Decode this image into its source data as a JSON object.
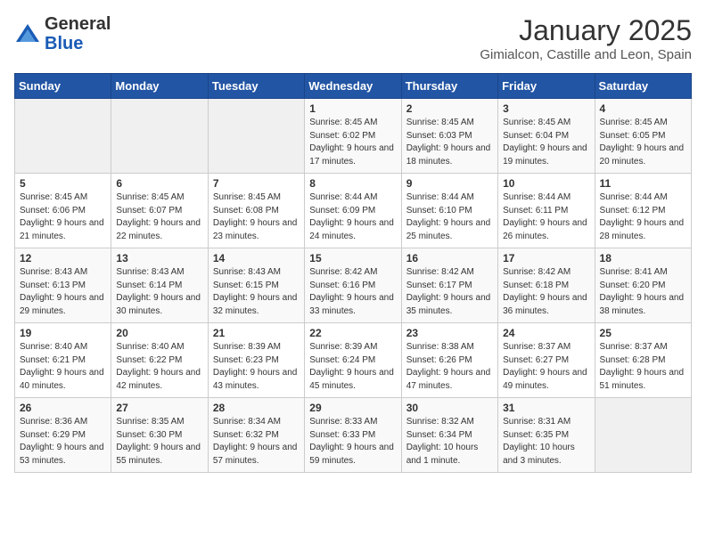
{
  "header": {
    "logo_line1": "General",
    "logo_line2": "Blue",
    "month_title": "January 2025",
    "subtitle": "Gimialcon, Castille and Leon, Spain"
  },
  "weekdays": [
    "Sunday",
    "Monday",
    "Tuesday",
    "Wednesday",
    "Thursday",
    "Friday",
    "Saturday"
  ],
  "weeks": [
    [
      {
        "day": "",
        "info": ""
      },
      {
        "day": "",
        "info": ""
      },
      {
        "day": "",
        "info": ""
      },
      {
        "day": "1",
        "info": "Sunrise: 8:45 AM\nSunset: 6:02 PM\nDaylight: 9 hours and 17 minutes."
      },
      {
        "day": "2",
        "info": "Sunrise: 8:45 AM\nSunset: 6:03 PM\nDaylight: 9 hours and 18 minutes."
      },
      {
        "day": "3",
        "info": "Sunrise: 8:45 AM\nSunset: 6:04 PM\nDaylight: 9 hours and 19 minutes."
      },
      {
        "day": "4",
        "info": "Sunrise: 8:45 AM\nSunset: 6:05 PM\nDaylight: 9 hours and 20 minutes."
      }
    ],
    [
      {
        "day": "5",
        "info": "Sunrise: 8:45 AM\nSunset: 6:06 PM\nDaylight: 9 hours and 21 minutes."
      },
      {
        "day": "6",
        "info": "Sunrise: 8:45 AM\nSunset: 6:07 PM\nDaylight: 9 hours and 22 minutes."
      },
      {
        "day": "7",
        "info": "Sunrise: 8:45 AM\nSunset: 6:08 PM\nDaylight: 9 hours and 23 minutes."
      },
      {
        "day": "8",
        "info": "Sunrise: 8:44 AM\nSunset: 6:09 PM\nDaylight: 9 hours and 24 minutes."
      },
      {
        "day": "9",
        "info": "Sunrise: 8:44 AM\nSunset: 6:10 PM\nDaylight: 9 hours and 25 minutes."
      },
      {
        "day": "10",
        "info": "Sunrise: 8:44 AM\nSunset: 6:11 PM\nDaylight: 9 hours and 26 minutes."
      },
      {
        "day": "11",
        "info": "Sunrise: 8:44 AM\nSunset: 6:12 PM\nDaylight: 9 hours and 28 minutes."
      }
    ],
    [
      {
        "day": "12",
        "info": "Sunrise: 8:43 AM\nSunset: 6:13 PM\nDaylight: 9 hours and 29 minutes."
      },
      {
        "day": "13",
        "info": "Sunrise: 8:43 AM\nSunset: 6:14 PM\nDaylight: 9 hours and 30 minutes."
      },
      {
        "day": "14",
        "info": "Sunrise: 8:43 AM\nSunset: 6:15 PM\nDaylight: 9 hours and 32 minutes."
      },
      {
        "day": "15",
        "info": "Sunrise: 8:42 AM\nSunset: 6:16 PM\nDaylight: 9 hours and 33 minutes."
      },
      {
        "day": "16",
        "info": "Sunrise: 8:42 AM\nSunset: 6:17 PM\nDaylight: 9 hours and 35 minutes."
      },
      {
        "day": "17",
        "info": "Sunrise: 8:42 AM\nSunset: 6:18 PM\nDaylight: 9 hours and 36 minutes."
      },
      {
        "day": "18",
        "info": "Sunrise: 8:41 AM\nSunset: 6:20 PM\nDaylight: 9 hours and 38 minutes."
      }
    ],
    [
      {
        "day": "19",
        "info": "Sunrise: 8:40 AM\nSunset: 6:21 PM\nDaylight: 9 hours and 40 minutes."
      },
      {
        "day": "20",
        "info": "Sunrise: 8:40 AM\nSunset: 6:22 PM\nDaylight: 9 hours and 42 minutes."
      },
      {
        "day": "21",
        "info": "Sunrise: 8:39 AM\nSunset: 6:23 PM\nDaylight: 9 hours and 43 minutes."
      },
      {
        "day": "22",
        "info": "Sunrise: 8:39 AM\nSunset: 6:24 PM\nDaylight: 9 hours and 45 minutes."
      },
      {
        "day": "23",
        "info": "Sunrise: 8:38 AM\nSunset: 6:26 PM\nDaylight: 9 hours and 47 minutes."
      },
      {
        "day": "24",
        "info": "Sunrise: 8:37 AM\nSunset: 6:27 PM\nDaylight: 9 hours and 49 minutes."
      },
      {
        "day": "25",
        "info": "Sunrise: 8:37 AM\nSunset: 6:28 PM\nDaylight: 9 hours and 51 minutes."
      }
    ],
    [
      {
        "day": "26",
        "info": "Sunrise: 8:36 AM\nSunset: 6:29 PM\nDaylight: 9 hours and 53 minutes."
      },
      {
        "day": "27",
        "info": "Sunrise: 8:35 AM\nSunset: 6:30 PM\nDaylight: 9 hours and 55 minutes."
      },
      {
        "day": "28",
        "info": "Sunrise: 8:34 AM\nSunset: 6:32 PM\nDaylight: 9 hours and 57 minutes."
      },
      {
        "day": "29",
        "info": "Sunrise: 8:33 AM\nSunset: 6:33 PM\nDaylight: 9 hours and 59 minutes."
      },
      {
        "day": "30",
        "info": "Sunrise: 8:32 AM\nSunset: 6:34 PM\nDaylight: 10 hours and 1 minute."
      },
      {
        "day": "31",
        "info": "Sunrise: 8:31 AM\nSunset: 6:35 PM\nDaylight: 10 hours and 3 minutes."
      },
      {
        "day": "",
        "info": ""
      }
    ]
  ]
}
